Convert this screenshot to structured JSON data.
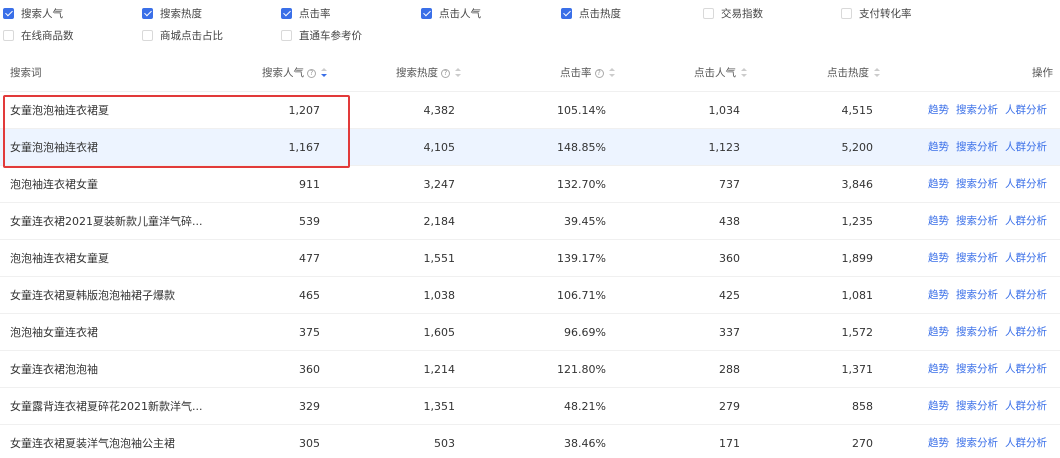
{
  "filters": [
    {
      "label": "搜索人气",
      "checked": true
    },
    {
      "label": "搜索热度",
      "checked": true
    },
    {
      "label": "点击率",
      "checked": true
    },
    {
      "label": "点击人气",
      "checked": true
    },
    {
      "label": "点击热度",
      "checked": true
    },
    {
      "label": "交易指数",
      "checked": false
    },
    {
      "label": "支付转化率",
      "checked": false
    },
    {
      "label": "在线商品数",
      "checked": false
    },
    {
      "label": "商城点击占比",
      "checked": false
    },
    {
      "label": "直通车参考价",
      "checked": false
    }
  ],
  "table": {
    "headers": {
      "keyword": "搜索词",
      "search_popularity": "搜索人气",
      "search_heat": "搜索热度",
      "ctr": "点击率",
      "click_popularity": "点击人气",
      "click_heat": "点击热度",
      "actions": "操作"
    },
    "info_glyph": "?",
    "actions": {
      "trend": "趋势",
      "search_analysis": "搜索分析",
      "crowd_analysis": "人群分析"
    },
    "rows": [
      {
        "keyword": "女童泡泡袖连衣裙夏",
        "search_popularity": "1,207",
        "search_heat": "4,382",
        "ctr": "105.14%",
        "click_popularity": "1,034",
        "click_heat": "4,515"
      },
      {
        "keyword": "女童泡泡袖连衣裙",
        "search_popularity": "1,167",
        "search_heat": "4,105",
        "ctr": "148.85%",
        "click_popularity": "1,123",
        "click_heat": "5,200"
      },
      {
        "keyword": "泡泡袖连衣裙女童",
        "search_popularity": "911",
        "search_heat": "3,247",
        "ctr": "132.70%",
        "click_popularity": "737",
        "click_heat": "3,846"
      },
      {
        "keyword": "女童连衣裙2021夏装新款儿童洋气碎...",
        "search_popularity": "539",
        "search_heat": "2,184",
        "ctr": "39.45%",
        "click_popularity": "438",
        "click_heat": "1,235"
      },
      {
        "keyword": "泡泡袖连衣裙女童夏",
        "search_popularity": "477",
        "search_heat": "1,551",
        "ctr": "139.17%",
        "click_popularity": "360",
        "click_heat": "1,899"
      },
      {
        "keyword": "女童连衣裙夏韩版泡泡袖裙子爆款",
        "search_popularity": "465",
        "search_heat": "1,038",
        "ctr": "106.71%",
        "click_popularity": "425",
        "click_heat": "1,081"
      },
      {
        "keyword": "泡泡袖女童连衣裙",
        "search_popularity": "375",
        "search_heat": "1,605",
        "ctr": "96.69%",
        "click_popularity": "337",
        "click_heat": "1,572"
      },
      {
        "keyword": "女童连衣裙泡泡袖",
        "search_popularity": "360",
        "search_heat": "1,214",
        "ctr": "121.80%",
        "click_popularity": "288",
        "click_heat": "1,371"
      },
      {
        "keyword": "女童露背连衣裙夏碎花2021新款洋气...",
        "search_popularity": "329",
        "search_heat": "1,351",
        "ctr": "48.21%",
        "click_popularity": "279",
        "click_heat": "858"
      },
      {
        "keyword": "女童连衣裙夏装洋气泡泡袖公主裙",
        "search_popularity": "305",
        "search_heat": "503",
        "ctr": "38.46%",
        "click_popularity": "171",
        "click_heat": "270"
      }
    ],
    "highlighted_row_index": 1,
    "accent_color": "#3a6fe8",
    "annotation_color": "#e23a3a"
  }
}
